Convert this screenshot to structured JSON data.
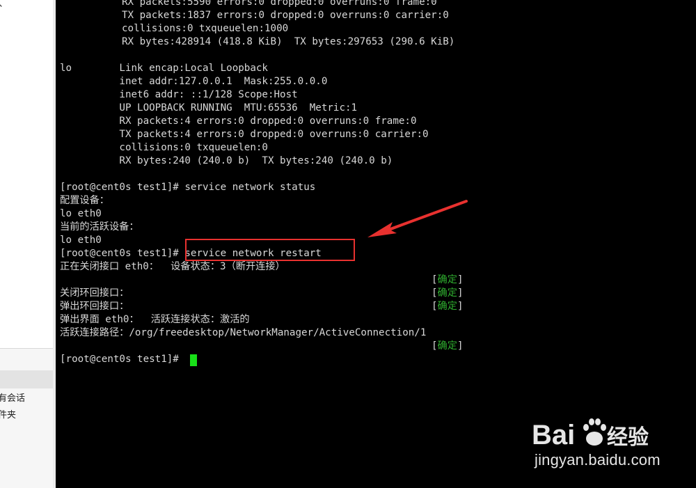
{
  "sidebar": {
    "top_glyph": "、",
    "items": [
      "有会话",
      "件夹"
    ]
  },
  "terminal": {
    "lines": [
      "RX packets:5590 errors:0 dropped:0 overruns:0 frame:0",
      "TX packets:1837 errors:0 dropped:0 overruns:0 carrier:0",
      "collisions:0 txqueuelen:1000",
      "RX bytes:428914 (418.8 KiB)  TX bytes:297653 (290.6 KiB)",
      "",
      "lo        Link encap:Local Loopback",
      "          inet addr:127.0.0.1  Mask:255.0.0.0",
      "          inet6 addr: ::1/128 Scope:Host",
      "          UP LOOPBACK RUNNING  MTU:65536  Metric:1",
      "          RX packets:4 errors:0 dropped:0 overruns:0 frame:0",
      "          TX packets:4 errors:0 dropped:0 overruns:0 carrier:0",
      "          collisions:0 txqueuelen:0",
      "          RX bytes:240 (240.0 b)  TX bytes:240 (240.0 b)",
      "",
      "[root@cent0s test1]# service network status",
      "配置设备：",
      "lo eth0",
      "当前的活跃设备：",
      "lo eth0",
      "[root@cent0s test1]# service network restart",
      "正在关闭接口 eth0：  设备状态：3（断开连接）",
      "",
      "关闭环回接口：",
      "弹出环回接口：",
      "弹出界面 eth0：  活跃连接状态：激活的",
      "活跃连接路径：/org/freedesktop/NetworkManager/ActiveConnection/1",
      "",
      "[root@cent0s test1]# "
    ],
    "ok_label": "确定",
    "ok_open": "[",
    "ok_close": "]"
  },
  "watermark": {
    "url": "jingyan.baidu.com",
    "brand": "Bai du 经验"
  },
  "colors": {
    "annotation": "#e8312f",
    "cursor": "#18e018",
    "ok_text": "#2fae2f"
  }
}
